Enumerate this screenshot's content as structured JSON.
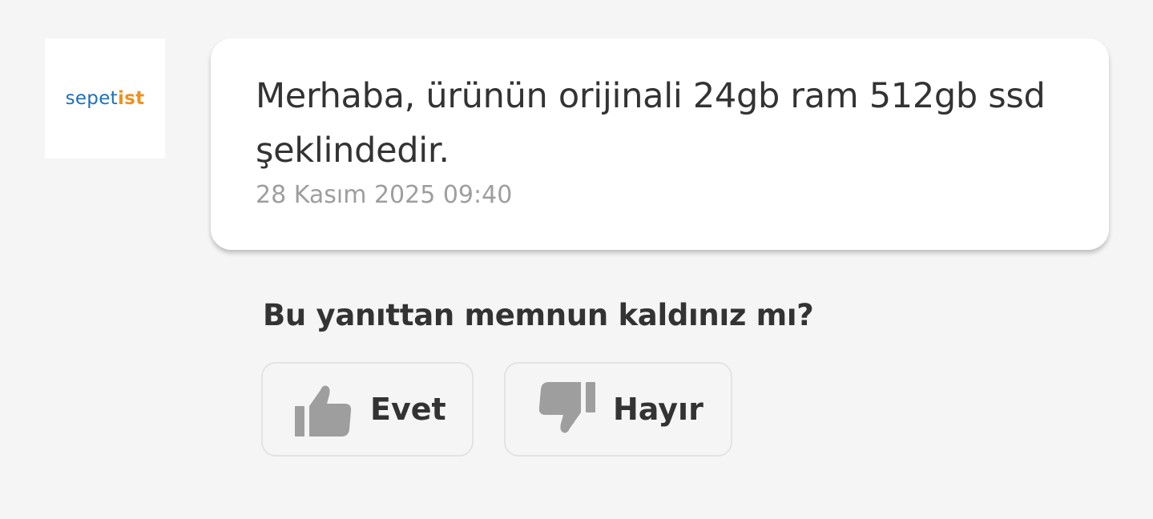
{
  "seller": {
    "logo_part1": "sepet",
    "logo_part2": "ist",
    "logo_colors": {
      "primary": "#1f6fb8",
      "accent": "#f0901e"
    }
  },
  "message": {
    "text": "Merhaba, ürünün orijinali 24gb ram 512gb ssd şeklindedir.",
    "timestamp": "28 Kasım 2025 09:40"
  },
  "feedback": {
    "question": "Bu yanıttan memnun kaldınız mı?",
    "yes": {
      "label": "Evet",
      "icon": "thumbs-up-icon"
    },
    "no": {
      "label": "Hayır",
      "icon": "thumbs-down-icon"
    },
    "icon_color": "#9e9e9e"
  }
}
